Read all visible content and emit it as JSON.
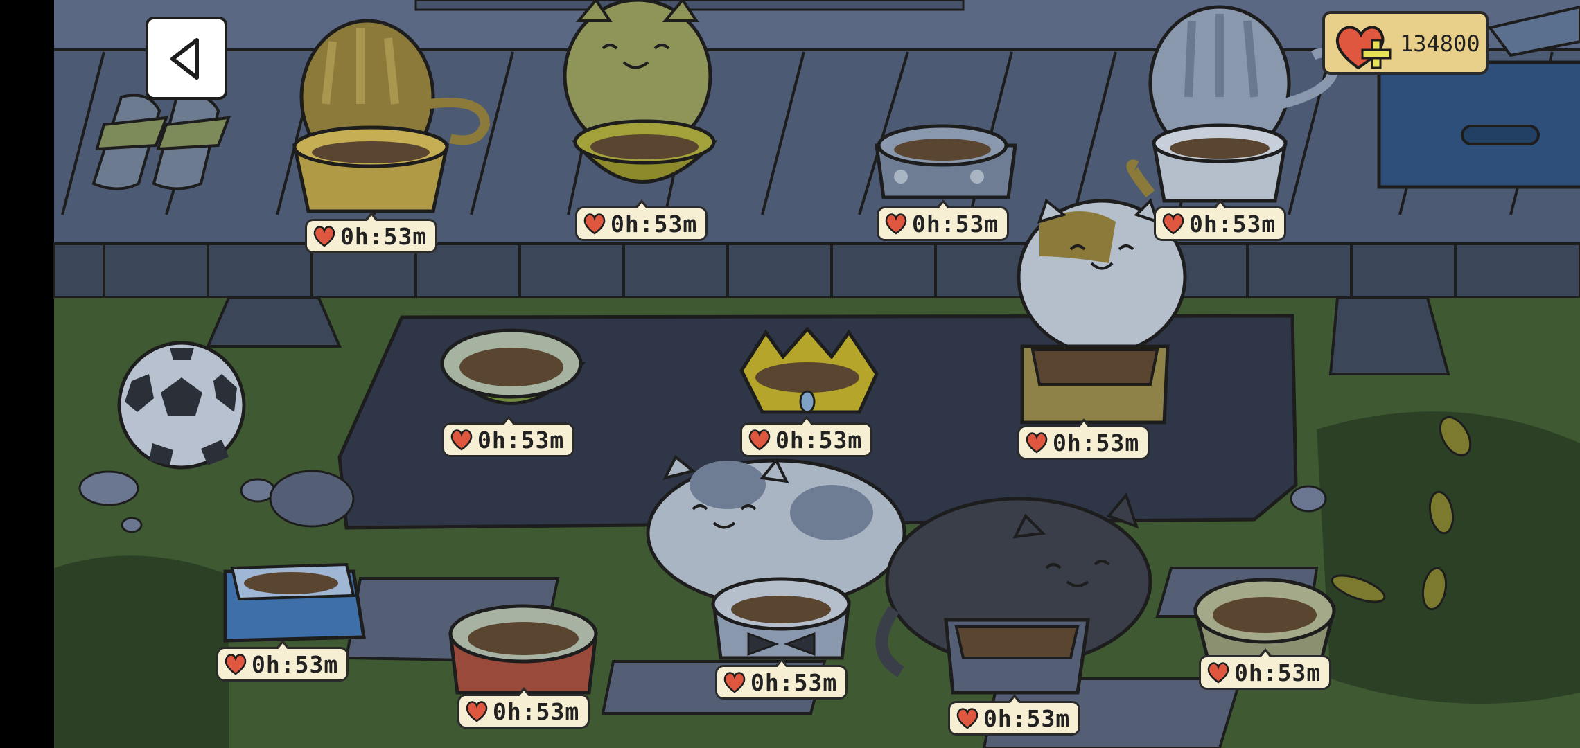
{
  "colors": {
    "deck": "#4c5a73",
    "deck_dark": "#2e3648",
    "grass": "#3f5a33",
    "grass_dark": "#2c4025",
    "bubble_bg": "#f6efd4",
    "heart": "#e0573f",
    "outline": "#1d1d1d"
  },
  "ui": {
    "back_icon": "back-arrow-icon",
    "hearts_count": "134800"
  },
  "timers": [
    {
      "label": "0h:53m",
      "name": "timer-bowl-paw-yellow"
    },
    {
      "label": "0h:53m",
      "name": "timer-bowl-olive"
    },
    {
      "label": "0h:53m",
      "name": "timer-bowl-dotted-gray"
    },
    {
      "label": "0h:53m",
      "name": "timer-bowl-white-deck"
    },
    {
      "label": "0h:53m",
      "name": "timer-bowl-green-leaf"
    },
    {
      "label": "0h:53m",
      "name": "timer-bowl-crown"
    },
    {
      "label": "0h:53m",
      "name": "timer-bowl-wooden-box"
    },
    {
      "label": "0h:53m",
      "name": "timer-bowl-blue-wave"
    },
    {
      "label": "0h:53m",
      "name": "timer-bowl-red-dotted"
    },
    {
      "label": "0h:53m",
      "name": "timer-bowl-bowtie"
    },
    {
      "label": "0h:53m",
      "name": "timer-bowl-square-tray"
    },
    {
      "label": "0h:53m",
      "name": "timer-bowl-sage"
    }
  ]
}
